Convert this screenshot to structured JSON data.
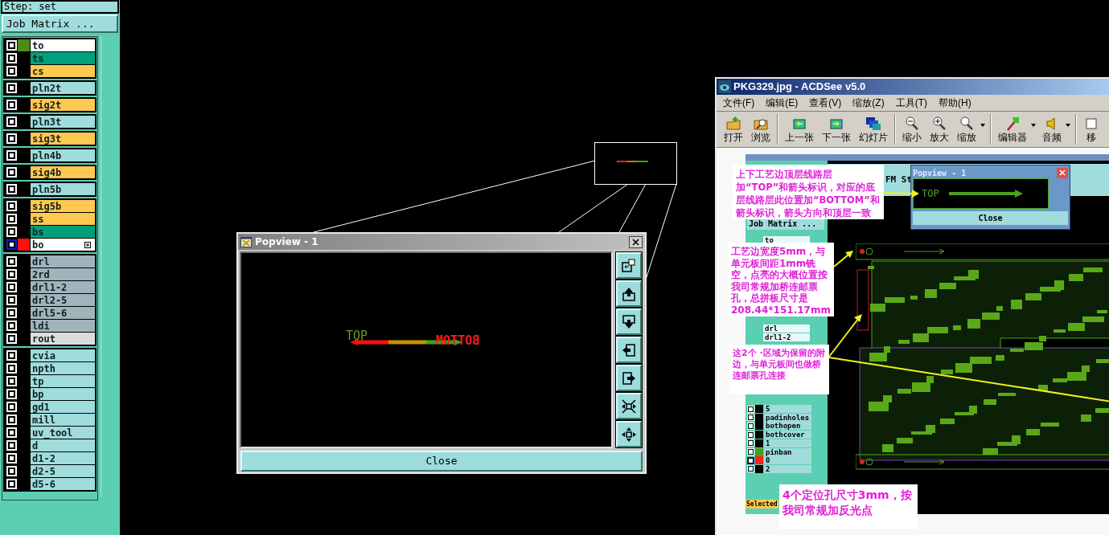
{
  "panel": {
    "step": "Step: set",
    "job_matrix": "Job Matrix ..."
  },
  "layer_groups": [
    [
      {
        "name": "to",
        "color": "#ffffff",
        "marker": {
          "color": "#4c8c18"
        },
        "selected": false
      },
      {
        "name": "ts",
        "color": "#00a07c",
        "selected": false
      },
      {
        "name": "cs",
        "color": "#ffc850",
        "selected": false
      }
    ],
    [
      {
        "name": "pln2t",
        "color": "#a0dcdc",
        "selected": false
      }
    ],
    [
      {
        "name": "sig2t",
        "color": "#ffc850",
        "selected": false
      }
    ],
    [
      {
        "name": "pln3t",
        "color": "#a0dcdc",
        "selected": false
      }
    ],
    [
      {
        "name": "sig3t",
        "color": "#ffc850",
        "selected": false
      }
    ],
    [
      {
        "name": "pln4b",
        "color": "#a0dcdc",
        "selected": false
      }
    ],
    [
      {
        "name": "sig4b",
        "color": "#ffc850",
        "selected": false
      }
    ],
    [
      {
        "name": "pln5b",
        "color": "#a0dcdc",
        "selected": false
      }
    ],
    [
      {
        "name": "sig5b",
        "color": "#ffc850",
        "selected": false
      },
      {
        "name": "ss",
        "color": "#ffc850",
        "selected": false
      },
      {
        "name": "bs",
        "color": "#00a07c",
        "selected": false
      },
      {
        "name": "bo",
        "color": "#ffffff",
        "marker": {
          "color": "#ff1010"
        },
        "selected": true
      }
    ],
    [
      {
        "name": "drl",
        "color": "#a0b4bc",
        "selected": false
      },
      {
        "name": "2rd",
        "color": "#a0b4bc",
        "selected": false
      },
      {
        "name": "drl1-2",
        "color": "#a0b4bc",
        "selected": false
      },
      {
        "name": "drl2-5",
        "color": "#a0b4bc",
        "selected": false
      },
      {
        "name": "drl5-6",
        "color": "#a0b4bc",
        "selected": false
      },
      {
        "name": "ldi",
        "color": "#a0b4bc",
        "selected": false
      },
      {
        "name": "rout",
        "color": "#dcdcdc",
        "selected": false
      }
    ],
    [
      {
        "name": "cvia",
        "color": "#a0dcdc",
        "selected": false
      },
      {
        "name": "npth",
        "color": "#a0dcdc",
        "selected": false
      },
      {
        "name": "tp",
        "color": "#a0dcdc",
        "selected": false
      },
      {
        "name": "bp",
        "color": "#a0dcdc",
        "selected": false
      },
      {
        "name": "gd1",
        "color": "#a0dcdc",
        "selected": false
      },
      {
        "name": "mill",
        "color": "#a0dcdc",
        "selected": false
      },
      {
        "name": "uv_tool",
        "color": "#a0dcdc",
        "selected": false
      },
      {
        "name": "d",
        "color": "#a0dcdc",
        "selected": false
      },
      {
        "name": "d1-2",
        "color": "#a0dcdc",
        "selected": false
      },
      {
        "name": "d2-5",
        "color": "#a0dcdc",
        "selected": false
      },
      {
        "name": "d5-6",
        "color": "#a0dcdc",
        "selected": false
      }
    ]
  ],
  "popview": {
    "title": "Popview - 1",
    "top_label": "TOP",
    "bottom_label": "BOTTOM",
    "bottom_mirrored": true,
    "close": "Close"
  },
  "acdsee": {
    "title": "PKG329.jpg - ACDSee v5.0",
    "menu": [
      "文件(F)",
      "编辑(E)",
      "查看(V)",
      "缩放(Z)",
      "工具(T)",
      "帮助(H)"
    ],
    "toolbar": [
      [
        {
          "kind": "open",
          "label": "打开",
          "dropdown": false
        },
        {
          "kind": "browse",
          "label": "浏览",
          "dropdown": false
        }
      ],
      [
        {
          "kind": "prev",
          "label": "上一张",
          "dropdown": false
        },
        {
          "kind": "next",
          "label": "下一张",
          "dropdown": false
        },
        {
          "kind": "slideshow",
          "label": "幻灯片",
          "dropdown": false
        }
      ],
      [
        {
          "kind": "zoom_out",
          "label": "缩小",
          "dropdown": false
        },
        {
          "kind": "zoom_in",
          "label": "放大",
          "dropdown": false
        },
        {
          "kind": "zoom",
          "label": "缩放",
          "dropdown": true
        }
      ],
      [
        {
          "kind": "editor",
          "label": "编辑器",
          "dropdown": true
        },
        {
          "kind": "audio",
          "label": "音频",
          "dropdown": true
        }
      ],
      [
        {
          "kind": "move",
          "label": "移",
          "dropdown": false
        }
      ]
    ],
    "image": {
      "header_text": "FM St",
      "job_matrix": "Job Matrix ...",
      "popview": {
        "title": "Popview - 1",
        "label": "TOP",
        "close": "Close"
      },
      "top_rows": [
        {
          "name": "to"
        },
        {
          "name": "drl"
        },
        {
          "name": "drl1-2"
        }
      ],
      "rows": [
        {
          "name": "5",
          "selected": false
        },
        {
          "name": "padinholes",
          "selected": false
        },
        {
          "name": "bothopen",
          "selected": false
        },
        {
          "name": "bothcover",
          "selected": false
        },
        {
          "name": "1",
          "selected": false
        },
        {
          "name": "pinban",
          "marker": {
            "color": "#4c9c18"
          },
          "selected": false
        },
        {
          "name": "0",
          "marker": {
            "color": "#ff2020"
          },
          "selected": true
        },
        {
          "name": "2",
          "selected": false
        }
      ],
      "selected_label": "Selected",
      "notes": [
        "上下工艺边顶层线路层加“TOP”和箭头标识，对应的底层线路层此位置加“BOTTOM”和箭头标识，箭头方向和顶层一致",
        "工艺边宽度5mm，与单元板间距1mm铣空，点亮的大概位置按我司常规加桥连邮票孔，总拼板尺寸是208.44*151.17mm",
        "这2个 ·区域为保留的附边，与单元板间也做桥连邮票孔连接",
        "4个定位孔尺寸3mm，按我司常规加反光点"
      ]
    }
  }
}
